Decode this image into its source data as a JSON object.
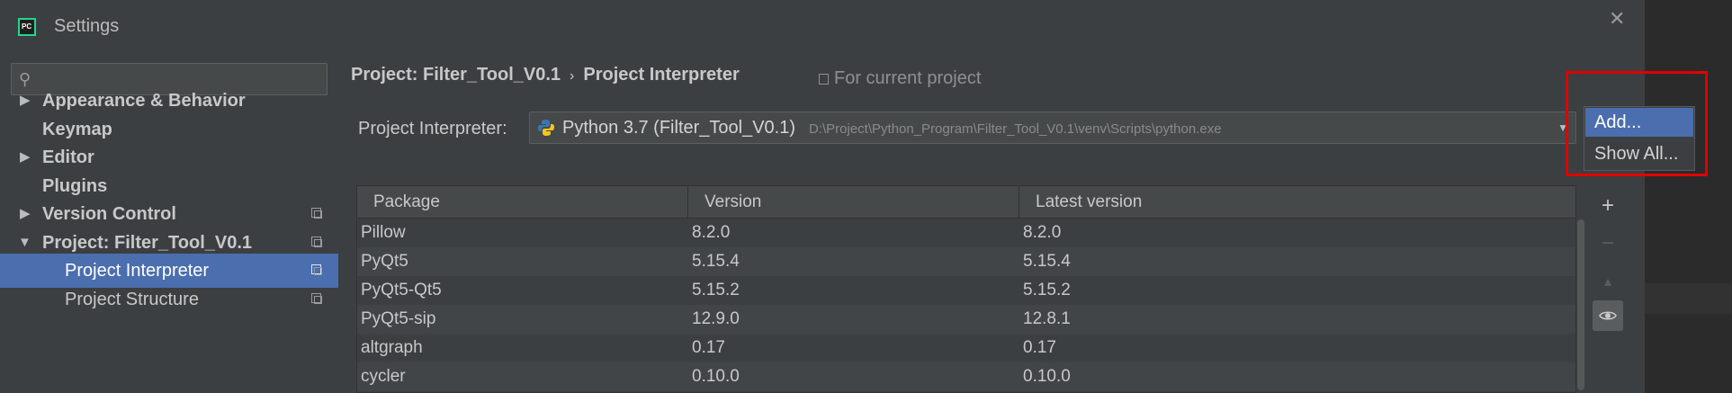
{
  "window": {
    "title": "Settings",
    "app_icon_text": "PC"
  },
  "search": {
    "placeholder": "",
    "value": ""
  },
  "sidebar": {
    "items": [
      {
        "label": "Appearance & Behavior",
        "expandable": true,
        "expanded": false,
        "bold": true
      },
      {
        "label": "Keymap",
        "expandable": false,
        "bold": true
      },
      {
        "label": "Editor",
        "expandable": true,
        "expanded": false,
        "bold": true
      },
      {
        "label": "Plugins",
        "expandable": false,
        "bold": true
      },
      {
        "label": "Version Control",
        "expandable": true,
        "expanded": false,
        "bold": true
      },
      {
        "label": "Project: Filter_Tool_V0.1",
        "expandable": true,
        "expanded": true,
        "bold": true
      },
      {
        "label": "Project Interpreter",
        "child": true,
        "selected": true
      },
      {
        "label": "Project Structure",
        "child": true
      }
    ]
  },
  "breadcrumb": {
    "project": "Project: Filter_Tool_V0.1",
    "separator": "›",
    "page": "Project Interpreter"
  },
  "scope_hint": "For current project",
  "interpreter": {
    "label": "Project Interpreter:",
    "name": "Python 3.7 (Filter_Tool_V0.1)",
    "path": "D:\\Project\\Python_Program\\Filter_Tool_V0.1\\venv\\Scripts\\python.exe"
  },
  "popup_menu": {
    "items": [
      "Add...",
      "Show All..."
    ],
    "selected_index": 0
  },
  "table": {
    "columns": [
      "Package",
      "Version",
      "Latest version"
    ],
    "rows": [
      [
        "Pillow",
        "8.2.0",
        "8.2.0"
      ],
      [
        "PyQt5",
        "5.15.4",
        "5.15.4"
      ],
      [
        "PyQt5-Qt5",
        "5.15.2",
        "5.15.2"
      ],
      [
        "PyQt5-sip",
        "12.9.0",
        "12.8.1"
      ],
      [
        "altgraph",
        "0.17",
        "0.17"
      ],
      [
        "cycler",
        "0.10.0",
        "0.10.0"
      ]
    ]
  },
  "tools": {
    "add": "+",
    "remove": "−",
    "upgrade": "▲",
    "eye": "👁"
  },
  "colors": {
    "selection": "#4b6eaf",
    "highlight_box": "#e00000",
    "background": "#3c3f41"
  }
}
